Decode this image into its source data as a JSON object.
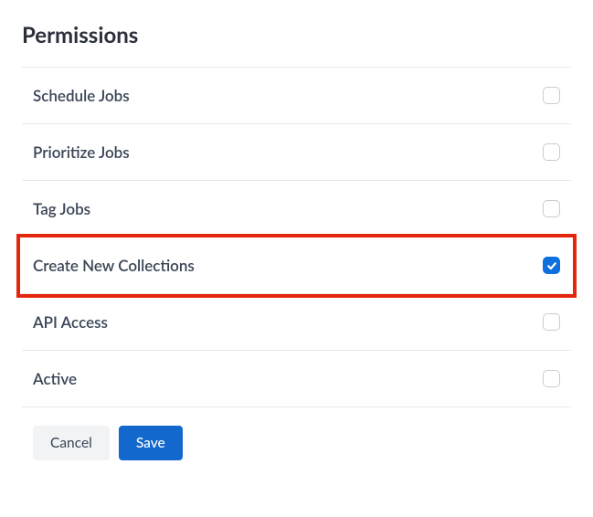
{
  "title": "Permissions",
  "permissions": [
    {
      "label": "Schedule Jobs",
      "checked": false
    },
    {
      "label": "Prioritize Jobs",
      "checked": false
    },
    {
      "label": "Tag Jobs",
      "checked": false
    },
    {
      "label": "Create New Collections",
      "checked": true
    },
    {
      "label": "API Access",
      "checked": false
    },
    {
      "label": "Active",
      "checked": false
    }
  ],
  "highlight_index": 3,
  "buttons": {
    "cancel": "Cancel",
    "save": "Save"
  }
}
